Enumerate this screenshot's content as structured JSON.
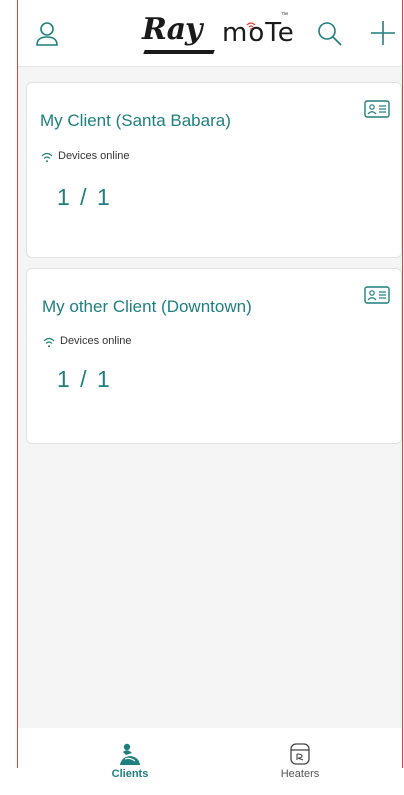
{
  "header": {
    "logo_text": "Ray moTe™",
    "icons": [
      "user-icon",
      "search-icon",
      "add-icon"
    ]
  },
  "clients": [
    {
      "name": "My Client (Santa Babara)",
      "status_label": "Devices online",
      "count": "1 / 1",
      "icon": "contact-card-icon"
    },
    {
      "name": "My other Client (Downtown)",
      "status_label": "Devices online",
      "count": "1 / 1",
      "icon": "contact-card-icon"
    }
  ],
  "bottom_nav": {
    "items": [
      {
        "label": "Clients",
        "icon": "clients-icon",
        "active": true
      },
      {
        "label": "Heaters",
        "icon": "heater-icon",
        "active": false
      }
    ]
  },
  "colors": {
    "accent": "#1f7f7f",
    "frame_border": "#e23c3c",
    "background": "#f5f5f5",
    "pointer": "#d2e7b4"
  }
}
